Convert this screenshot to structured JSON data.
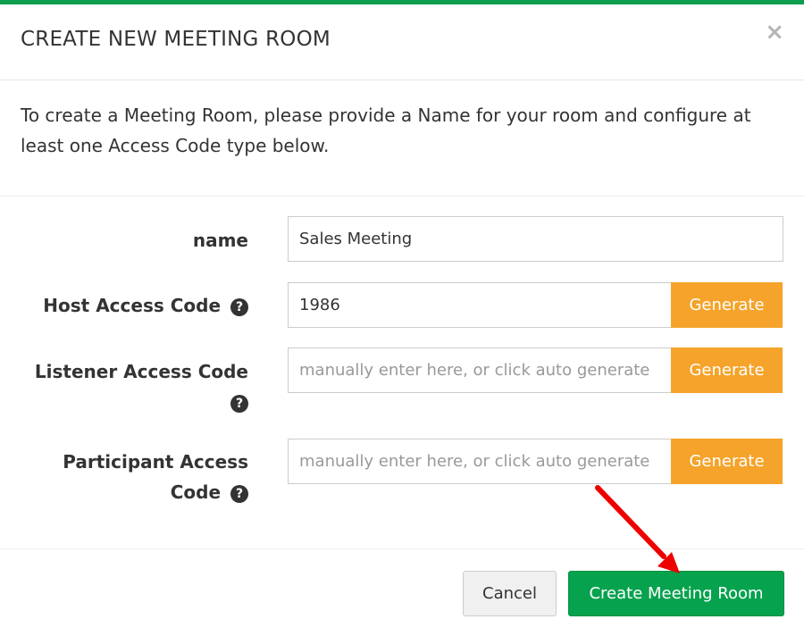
{
  "modal": {
    "title": "CREATE NEW MEETING ROOM",
    "close_label": "×",
    "intro": "To create a Meeting Room, please provide a Name for your room and configure at least one Access Code type below."
  },
  "form": {
    "name": {
      "label": "name",
      "value": "Sales Meeting"
    },
    "host": {
      "label": "Host Access Code",
      "value": "1986",
      "button": "Generate"
    },
    "listener": {
      "label": "Listener Access Code",
      "placeholder": "manually enter here, or click auto generate",
      "button": "Generate"
    },
    "participant": {
      "label_line1": "Participant Access",
      "label_line2": "Code",
      "placeholder": "manually enter here, or click auto generate",
      "button": "Generate"
    },
    "help_glyph": "?"
  },
  "footer": {
    "cancel_label": "Cancel",
    "create_label": "Create Meeting Room"
  },
  "colors": {
    "accent_green": "#07a24e",
    "generate_orange": "#f5a32a",
    "annotation_arrow": "#ee0000"
  },
  "icons": {
    "help": "question-circle-icon",
    "close": "close-icon",
    "annotation": "red-arrow-annotation"
  }
}
